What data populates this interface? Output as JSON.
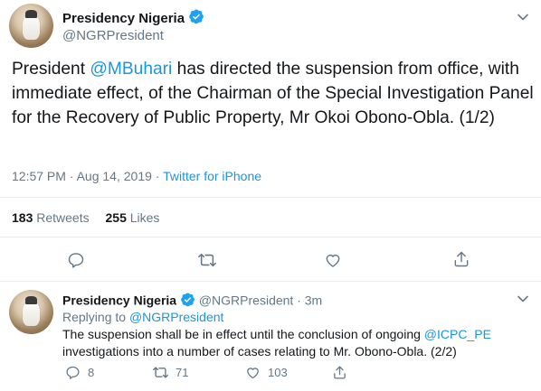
{
  "main_tweet": {
    "display_name": "Presidency Nigeria",
    "handle": "@NGRPresident",
    "text_before_mention": "President ",
    "mention": "@MBuhari",
    "text_after_mention": " has directed the suspension from office, with immediate effect, of the Chairman of the Special Investigation Panel for the Recovery of Public Property, Mr Okoi Obono-Obla. (1/2)",
    "timestamp": "12:57 PM · Aug 14, 2019 · ",
    "source": "Twitter for iPhone",
    "retweets_count": "183",
    "retweets_label": "Retweets",
    "likes_count": "255",
    "likes_label": "Likes"
  },
  "reply_tweet": {
    "display_name": "Presidency Nigeria",
    "handle": "@NGRPresident",
    "time": "· 3m",
    "replying_to_label": "Replying to ",
    "replying_to_handle": "@NGRPresident",
    "text_before_mention": "The suspension shall be in effect until the conclusion of ongoing ",
    "mention": "@ICPC_PE",
    "text_after_mention": " investigations into a number of cases relating to Mr. Obono-Obla. (2/2)",
    "reply_count": "8",
    "retweet_count": "71",
    "like_count": "103"
  },
  "colors": {
    "accent": "#1b95e0",
    "verified": "#1da1f2",
    "muted": "#657786",
    "divider": "#e6ecf0"
  },
  "icons": [
    "verified-badge-icon",
    "chevron-down-icon",
    "reply-icon",
    "retweet-icon",
    "like-icon",
    "share-icon"
  ]
}
